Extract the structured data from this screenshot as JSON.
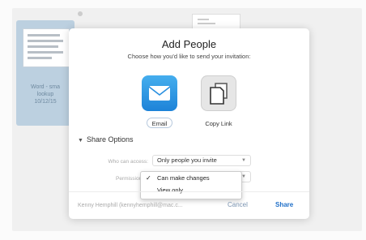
{
  "background": {
    "file_card": {
      "lines": [
        "Word - sma",
        "lookup",
        "10/12/15"
      ]
    }
  },
  "dialog": {
    "title": "Add People",
    "subtitle": "Choose how you'd like to send your invitation:",
    "options": [
      {
        "label": "Email",
        "icon": "mail-envelope-icon",
        "color": "#2a90e0"
      },
      {
        "label": "Copy Link",
        "icon": "copy-documents-icon",
        "color": "#e6e6e6"
      }
    ],
    "share_options_label": "Share Options",
    "who_can_access_label": "Who can access:",
    "who_can_access_value": "Only people you invite",
    "permission_label": "Permission:",
    "permission_menu": [
      {
        "label": "Can make changes",
        "checked": true
      },
      {
        "label": "View only",
        "checked": false
      }
    ],
    "from_account": "Kenny Hemphill (kennyhemphill@mac.c...",
    "cancel_label": "Cancel",
    "share_label": "Share",
    "accent_color": "#1f6fc8"
  }
}
